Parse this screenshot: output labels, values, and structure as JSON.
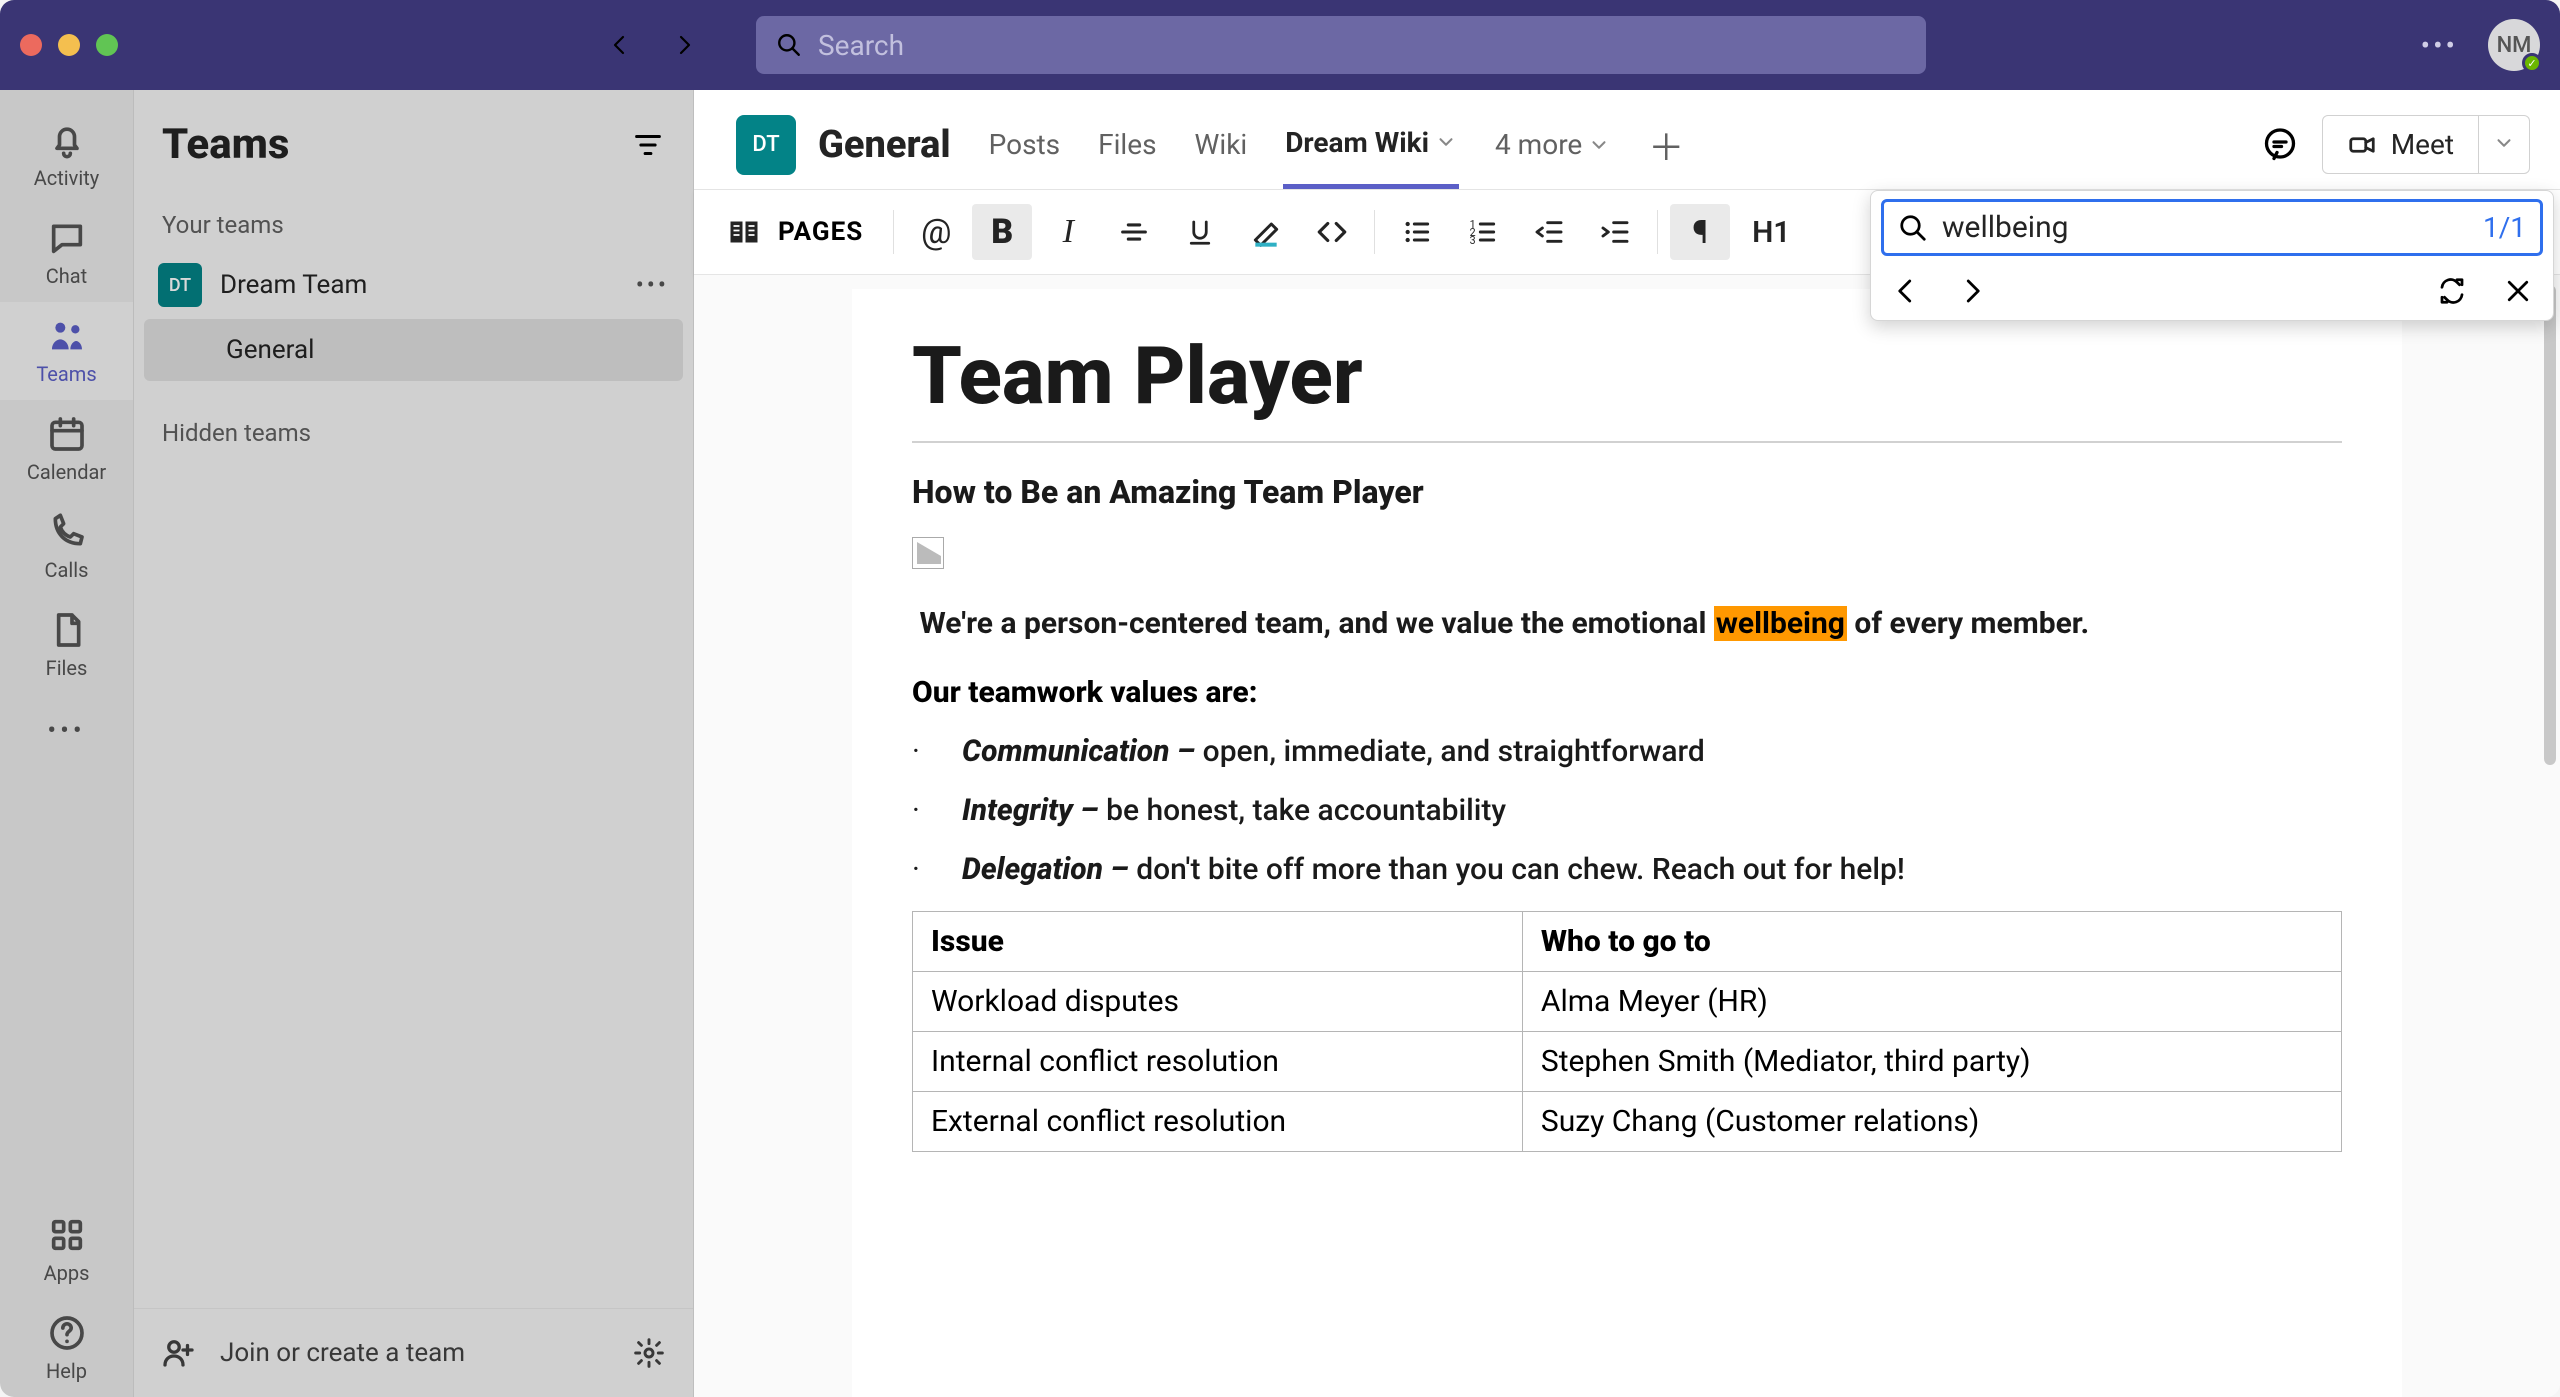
{
  "search_placeholder": "Search",
  "avatar_initials": "NM",
  "rail": {
    "activity": "Activity",
    "chat": "Chat",
    "teams": "Teams",
    "calendar": "Calendar",
    "calls": "Calls",
    "files": "Files",
    "apps": "Apps",
    "help": "Help"
  },
  "teams_panel": {
    "title": "Teams",
    "section_your_teams": "Your teams",
    "team_name": "Dream Team",
    "team_initials": "DT",
    "channel_general": "General",
    "section_hidden": "Hidden teams",
    "footer_join": "Join or create a team"
  },
  "channel": {
    "badge": "DT",
    "title": "General",
    "tabs": {
      "posts": "Posts",
      "files": "Files",
      "wiki": "Wiki",
      "dream_wiki": "Dream Wiki",
      "more": "4 more"
    },
    "meet": "Meet"
  },
  "wiki_toolbar": {
    "pages": "PAGES",
    "h1": "H1"
  },
  "find": {
    "value": "wellbeing",
    "count": "1/1"
  },
  "doc": {
    "title": "Team Player",
    "subtitle": "How to Be an Amazing Team Player",
    "sentence_prefix": "We're a person-centered team, and we value the emotional ",
    "sentence_highlight": "wellbeing",
    "sentence_suffix": " of every member.",
    "values_label": "Our teamwork values are:",
    "values": [
      {
        "name": "Communication –",
        "desc": "open, immediate, and straightforward"
      },
      {
        "name": "Integrity –",
        "desc": "be honest, take accountability"
      },
      {
        "name": "Delegation –",
        "desc": "don't bite off more than you can chew. Reach out for help!"
      }
    ],
    "table": {
      "headers": [
        "Issue",
        "Who to go to"
      ],
      "rows": [
        [
          "Workload disputes",
          "Alma Meyer (HR)"
        ],
        [
          "Internal conflict resolution",
          "Stephen Smith (Mediator, third party)"
        ],
        [
          "External conflict resolution",
          "Suzy Chang (Customer relations)"
        ]
      ]
    }
  }
}
